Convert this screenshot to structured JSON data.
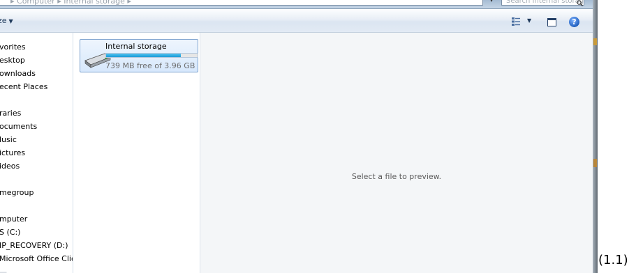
{
  "address_bar": {
    "path_text": "▸ Computer ▸ Internal storage ▸",
    "refresh_glyph": "▾",
    "search_placeholder": "Search Internal storage",
    "search_icon": "search-icon"
  },
  "toolbar": {
    "organize_label": "ze",
    "organize_arrow": "▼",
    "views_arrow": "▼",
    "help_label": "?"
  },
  "nav": {
    "items": [
      {
        "label": "vorites",
        "group": "favorites"
      },
      {
        "label": "esktop",
        "group": "favorites"
      },
      {
        "label": "ownloads",
        "group": "favorites"
      },
      {
        "label": "ecent Places",
        "group": "favorites"
      },
      {
        "label": "raries",
        "group": "libraries"
      },
      {
        "label": "ocuments",
        "group": "libraries"
      },
      {
        "label": "lusic",
        "group": "libraries"
      },
      {
        "label": "ictures",
        "group": "libraries"
      },
      {
        "label": "ideos",
        "group": "libraries"
      },
      {
        "label": "megroup",
        "group": "homegroup"
      },
      {
        "label": "mputer",
        "group": "computer"
      },
      {
        "label": "S (C:)",
        "group": "computer"
      },
      {
        "label": "IP_RECOVERY (D:)",
        "group": "computer"
      },
      {
        "label": "Microsoft Office Clic",
        "group": "computer"
      },
      {
        "label": "—",
        "group": "computer"
      }
    ]
  },
  "drive": {
    "name": "Internal storage",
    "free_text": "739 MB free of 3.96 GB",
    "used_fraction": 0.818,
    "bar_color": "#26a0da"
  },
  "preview": {
    "message": "Select a file to preview."
  },
  "caption": "(1.1)",
  "colors": {
    "accent": "#1e395b",
    "selection": "#d7e8fc",
    "selection_border": "#7da2ce"
  }
}
